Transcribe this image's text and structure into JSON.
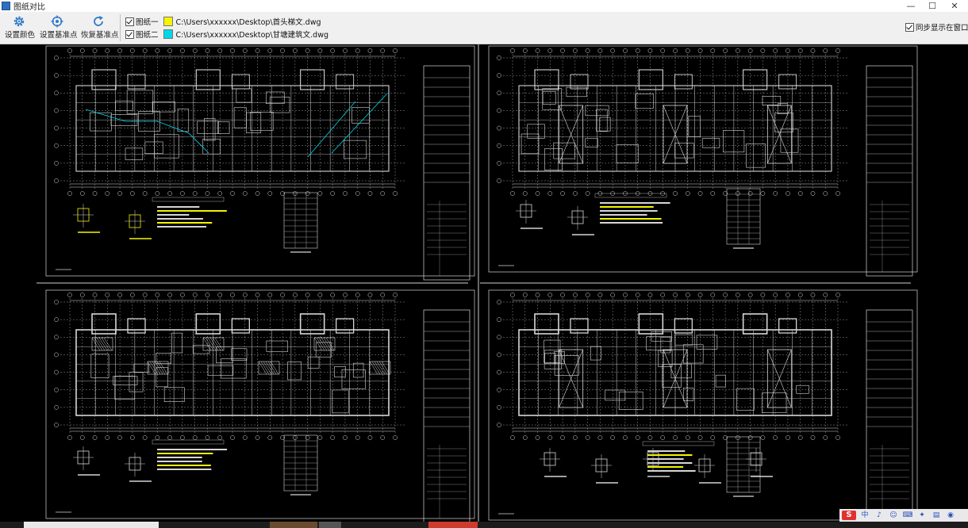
{
  "window": {
    "title": "图纸对比",
    "controls": {
      "minimize": "—",
      "maximize": "☐",
      "close": "✕"
    }
  },
  "toolbar": {
    "buttons": [
      {
        "label": "设置颜色",
        "icon": "gear-icon"
      },
      {
        "label": "设置基准点",
        "icon": "target-icon"
      },
      {
        "label": "恢复基准点",
        "icon": "refresh-icon"
      }
    ],
    "files": [
      {
        "label": "图纸一",
        "checked": true,
        "color": "#f5f500",
        "path": "C:\\Users\\xxxxxx\\Desktop\\首头梯文.dwg"
      },
      {
        "label": "图纸二",
        "checked": true,
        "color": "#00d8e8",
        "path": "C:\\Users\\xxxxxx\\Desktop\\甘塘建筑文.dwg"
      }
    ],
    "sync_option": {
      "label": "同步显示在窗口",
      "checked": true
    }
  },
  "colors": {
    "drawing1": "#f5f500",
    "drawing2": "#00d8e8",
    "lines": "#d6d6d6",
    "background": "#000000"
  },
  "canvas": {
    "panels": [
      {
        "id": "top-left"
      },
      {
        "id": "top-right"
      },
      {
        "id": "bottom-left"
      },
      {
        "id": "bottom-right"
      }
    ]
  },
  "ime": {
    "logo": "S",
    "items": [
      "中",
      "♪",
      "☺",
      "⌨",
      "✦",
      "▤",
      "◉",
      "⚙"
    ]
  }
}
